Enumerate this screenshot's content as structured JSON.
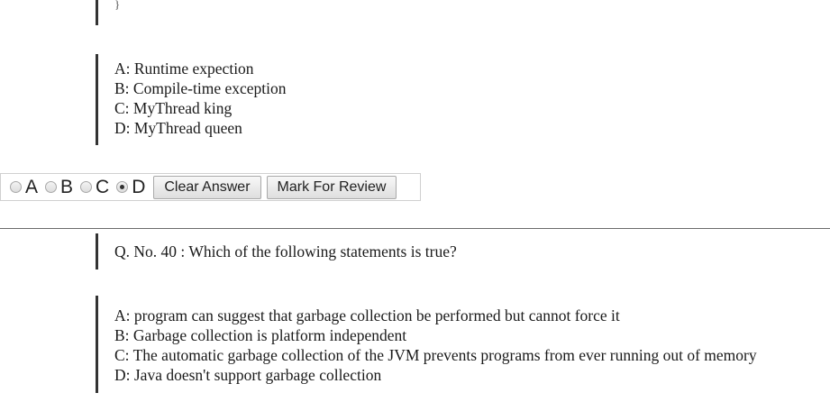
{
  "previous_question": {
    "code_tail": "}",
    "options": [
      "A: Runtime expection",
      "B: Compile-time exception",
      "C: MyThread king",
      "D: MyThread queen"
    ]
  },
  "answer_bar": {
    "choices": [
      "A",
      "B",
      "C",
      "D"
    ],
    "selected": "D",
    "clear_label": "Clear Answer",
    "review_label": "Mark For Review"
  },
  "current_question": {
    "text": "Q. No. 40 : Which of the following statements is true?",
    "options": [
      "A: program can suggest that garbage collection be performed but cannot force it",
      "B: Garbage collection is platform independent",
      "C: The automatic garbage collection of the JVM prevents programs from ever running out of memory",
      "D: Java doesn't support garbage collection"
    ]
  }
}
